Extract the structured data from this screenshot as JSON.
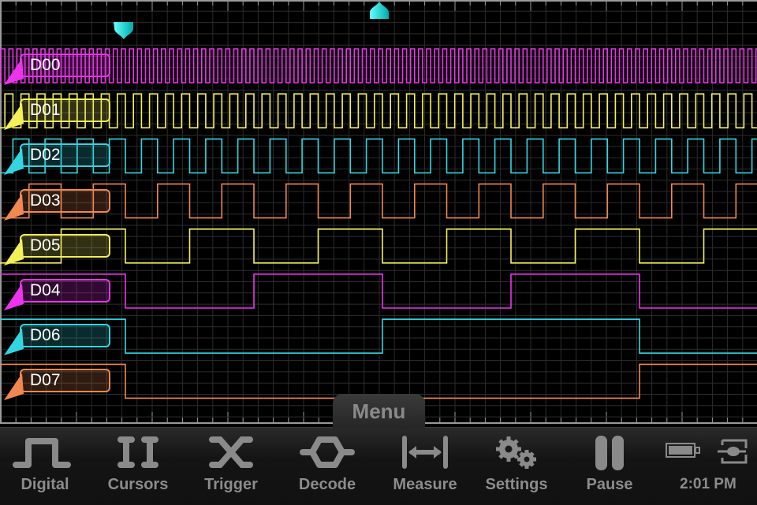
{
  "scope": {
    "grid_color": "#2c2c2c",
    "border_color": "#9a9a9a",
    "trigger_marker_color": "#19e0e6",
    "channels": [
      {
        "name": "D00",
        "color": "#ee33ee",
        "bit": 0
      },
      {
        "name": "D01",
        "color": "#f4f05a",
        "bit": 1
      },
      {
        "name": "D02",
        "color": "#33d6e0",
        "bit": 2
      },
      {
        "name": "D03",
        "color": "#f08850",
        "bit": 3
      },
      {
        "name": "D05",
        "color": "#f4f05a",
        "bit": 4
      },
      {
        "name": "D04",
        "color": "#ee33ee",
        "bit": 5
      },
      {
        "name": "D06",
        "color": "#33d6e0",
        "bit": 6
      },
      {
        "name": "D07",
        "color": "#f08850",
        "bit": 7
      }
    ]
  },
  "menu": {
    "label": "Menu"
  },
  "toolbar": {
    "items": [
      {
        "label": "Digital",
        "icon": "digital-pulse-icon"
      },
      {
        "label": "Cursors",
        "icon": "cursors-icon"
      },
      {
        "label": "Trigger",
        "icon": "trigger-icon"
      },
      {
        "label": "Decode",
        "icon": "decode-icon"
      },
      {
        "label": "Measure",
        "icon": "measure-icon"
      },
      {
        "label": "Settings",
        "icon": "gears-icon"
      },
      {
        "label": "Pause",
        "icon": "pause-icon"
      }
    ],
    "status": {
      "time": "2:01 PM",
      "battery_icon": "battery-icon",
      "connection_icon": "connection-icon"
    }
  }
}
